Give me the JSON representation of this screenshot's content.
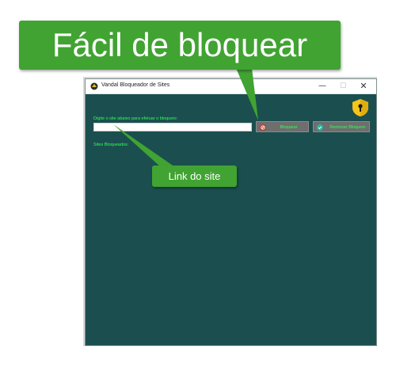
{
  "window": {
    "title": "Vandal Bloqueador  de Sites",
    "minimize_glyph": "—",
    "maximize_glyph": "☐",
    "close_glyph": "✕"
  },
  "form": {
    "input_label": "Digite o site abaixo para efetuar o bloqueio:",
    "input_value": "",
    "input_placeholder": "",
    "block_button_label": "Bloquear",
    "remove_button_label": "Remover Bloqueio",
    "blocked_sites_label": "Sites Bloqueados:"
  },
  "icons": {
    "app": "app-logo-icon",
    "shield": "shield-lock-icon",
    "block": "block-icon",
    "remove": "check-circle-icon"
  },
  "annotations": {
    "main_callout": "Fácil de bloquear",
    "small_callout": "Link do site"
  },
  "colors": {
    "window_bg": "#1b4f4f",
    "label_green": "#2cff55",
    "callout_green": "#41a332",
    "button_gray": "#6e6e6e",
    "shield_yellow": "#f5c518",
    "block_red": "#c0392b",
    "remove_teal": "#2bb3a0"
  }
}
